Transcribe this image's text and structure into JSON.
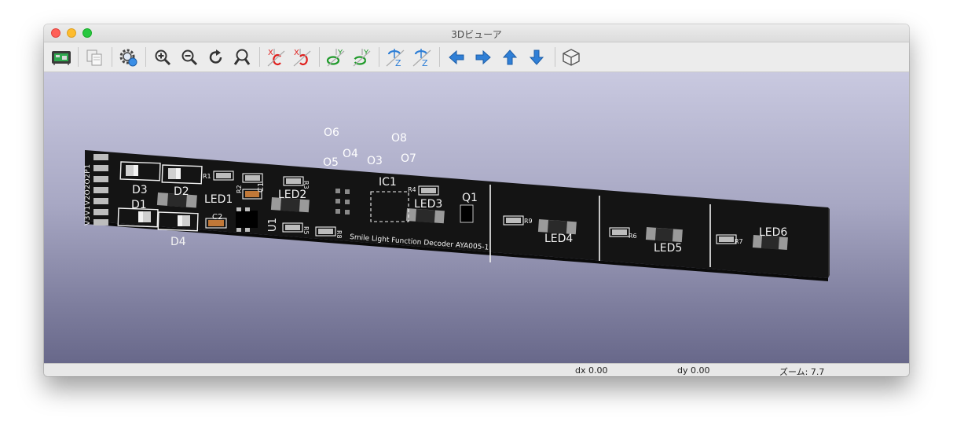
{
  "window": {
    "title": "3Dビューア"
  },
  "toolbar": {
    "buttons": [
      {
        "name": "render-raytracing-button",
        "icon": "pcb-render-icon"
      },
      {
        "name": "copy-image-button",
        "icon": "copy-icon"
      },
      {
        "name": "settings-button",
        "icon": "gear-icon"
      },
      {
        "name": "zoom-in-button",
        "icon": "zoom-in-icon"
      },
      {
        "name": "zoom-out-button",
        "icon": "zoom-out-icon"
      },
      {
        "name": "redraw-button",
        "icon": "redraw-icon"
      },
      {
        "name": "zoom-fit-button",
        "icon": "zoom-fit-icon"
      },
      {
        "name": "rotate-x-cw-button",
        "icon": "rotate-x-cw-icon",
        "axis": "X"
      },
      {
        "name": "rotate-x-ccw-button",
        "icon": "rotate-x-ccw-icon",
        "axis": "X"
      },
      {
        "name": "rotate-y-cw-button",
        "icon": "rotate-y-cw-icon",
        "axis": "Y"
      },
      {
        "name": "rotate-y-ccw-button",
        "icon": "rotate-y-ccw-icon",
        "axis": "Y"
      },
      {
        "name": "rotate-z-cw-button",
        "icon": "rotate-z-cw-icon",
        "axis": "Z"
      },
      {
        "name": "rotate-z-ccw-button",
        "icon": "rotate-z-ccw-icon",
        "axis": "Z"
      },
      {
        "name": "move-left-button",
        "icon": "arrow-left-icon"
      },
      {
        "name": "move-right-button",
        "icon": "arrow-right-icon"
      },
      {
        "name": "move-up-button",
        "icon": "arrow-up-icon"
      },
      {
        "name": "move-down-button",
        "icon": "arrow-down-icon"
      },
      {
        "name": "ortho-toggle-button",
        "icon": "cube-icon"
      }
    ],
    "colors": {
      "blue": "#2f7fd6",
      "red": "#e0201e",
      "green": "#1f9a2a",
      "dark": "#333333"
    }
  },
  "status": {
    "dx": "dx 0.00",
    "dy": "dy 0.00",
    "zoom": "ズーム: 7.7"
  },
  "board": {
    "silkscreen_text": "Smile Light Function Decoder AYA005-1",
    "edge_text": "V3V1V2O2O2P1",
    "refs": {
      "d3": "D3",
      "d2": "D2",
      "d1": "D1",
      "d4": "D4",
      "led1": "LED1",
      "led2": "LED2",
      "led3": "LED3",
      "led4": "LED4",
      "led5": "LED5",
      "led6": "LED6",
      "c2": "C2",
      "c1": "C1",
      "u1": "U1",
      "ic1": "IC1",
      "q1": "Q1",
      "r1": "R1",
      "r2": "R2",
      "r3": "R3",
      "r4": "R4",
      "r5": "R5",
      "r6": "R6",
      "r7": "R7",
      "r8": "R8",
      "r9": "R9"
    },
    "pad_labels": {
      "o3": "O3",
      "o4": "O4",
      "o5": "O5",
      "o6": "O6",
      "o7": "O7",
      "o8": "O8"
    },
    "colors": {
      "board": "#141414",
      "silk": "#f2f2f2",
      "pad": "#bdbdbd"
    }
  }
}
